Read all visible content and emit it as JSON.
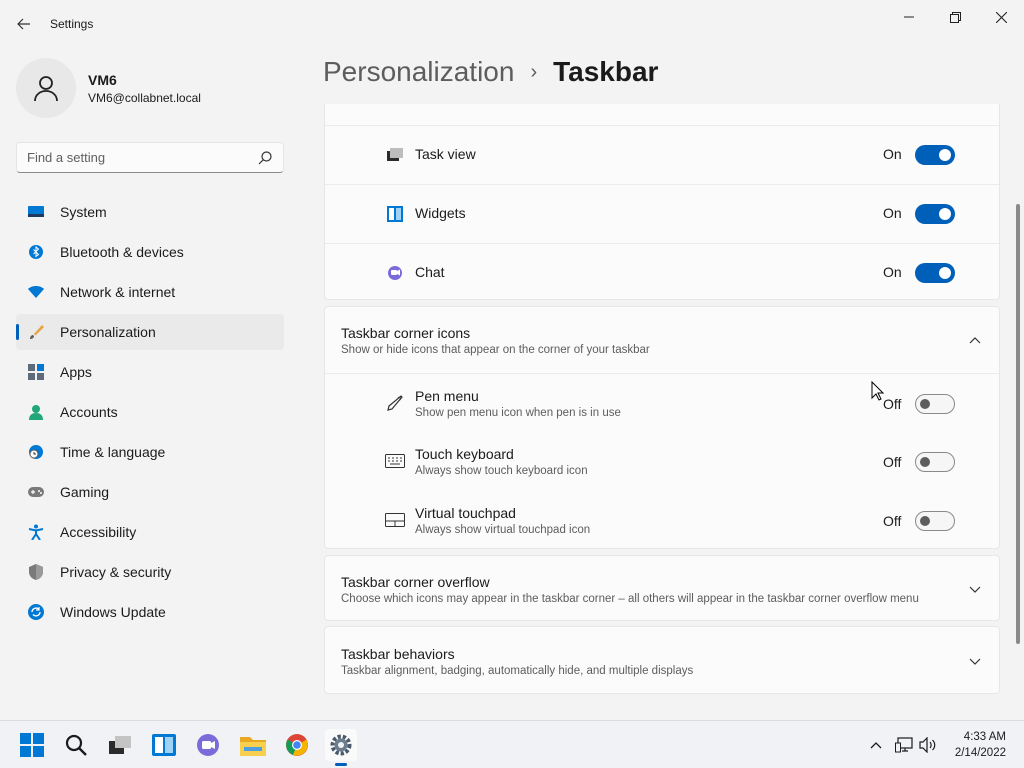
{
  "window": {
    "title": "Settings"
  },
  "user": {
    "name": "VM6",
    "email": "VM6@collabnet.local"
  },
  "search": {
    "placeholder": "Find a setting"
  },
  "nav": {
    "items": [
      {
        "label": "System",
        "icon": "monitor-icon"
      },
      {
        "label": "Bluetooth & devices",
        "icon": "bluetooth-icon"
      },
      {
        "label": "Network & internet",
        "icon": "wifi-icon"
      },
      {
        "label": "Personalization",
        "icon": "brush-icon",
        "active": true
      },
      {
        "label": "Apps",
        "icon": "apps-icon"
      },
      {
        "label": "Accounts",
        "icon": "person-icon"
      },
      {
        "label": "Time & language",
        "icon": "clock-globe-icon"
      },
      {
        "label": "Gaming",
        "icon": "gamepad-icon"
      },
      {
        "label": "Accessibility",
        "icon": "accessibility-icon"
      },
      {
        "label": "Privacy & security",
        "icon": "shield-icon"
      },
      {
        "label": "Windows Update",
        "icon": "update-icon"
      }
    ]
  },
  "breadcrumb": {
    "parent": "Personalization",
    "separator": "›",
    "current": "Taskbar"
  },
  "taskbar_items": [
    {
      "label": "Task view",
      "state": "On",
      "icon": "task-view-icon"
    },
    {
      "label": "Widgets",
      "state": "On",
      "icon": "widgets-icon"
    },
    {
      "label": "Chat",
      "state": "On",
      "icon": "chat-icon"
    }
  ],
  "corner_icons": {
    "title": "Taskbar corner icons",
    "description": "Show or hide icons that appear on the corner of your taskbar",
    "items": [
      {
        "label": "Pen menu",
        "description": "Show pen menu icon when pen is in use",
        "state": "Off",
        "icon": "pen-icon"
      },
      {
        "label": "Touch keyboard",
        "description": "Always show touch keyboard icon",
        "state": "Off",
        "icon": "keyboard-icon"
      },
      {
        "label": "Virtual touchpad",
        "description": "Always show virtual touchpad icon",
        "state": "Off",
        "icon": "touchpad-icon"
      }
    ]
  },
  "corner_overflow": {
    "title": "Taskbar corner overflow",
    "description": "Choose which icons may appear in the taskbar corner – all others will appear in the taskbar corner overflow menu"
  },
  "behaviors": {
    "title": "Taskbar behaviors",
    "description": "Taskbar alignment, badging, automatically hide, and multiple displays"
  },
  "clock": {
    "time": "4:33 AM",
    "date": "2/14/2022"
  },
  "colors": {
    "accent": "#005fb8",
    "background": "#f3f3f3",
    "card": "#fbfbfb"
  }
}
